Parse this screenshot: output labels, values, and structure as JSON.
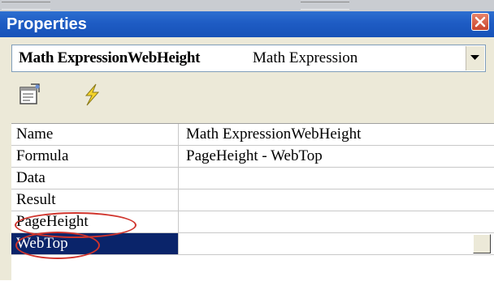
{
  "window": {
    "title": "Properties"
  },
  "object_selector": {
    "name": "Math ExpressionWebHeight",
    "type": "Math Expression"
  },
  "toolbar": {
    "buttons": [
      {
        "icon": "property-pages-icon"
      },
      {
        "icon": "events-lightning-icon"
      }
    ]
  },
  "properties": [
    {
      "name": "Name",
      "value": "Math ExpressionWebHeight"
    },
    {
      "name": "Formula",
      "value": "PageHeight - WebTop"
    },
    {
      "name": "Data",
      "value": ""
    },
    {
      "name": "Result",
      "value": ""
    },
    {
      "name": "PageHeight",
      "value": ""
    },
    {
      "name": "WebTop",
      "value": ""
    }
  ],
  "colors": {
    "titlebar": "#1e5cc4",
    "selection": "#0a246a",
    "annotation": "#d0342c",
    "panel": "#ece9d8"
  }
}
